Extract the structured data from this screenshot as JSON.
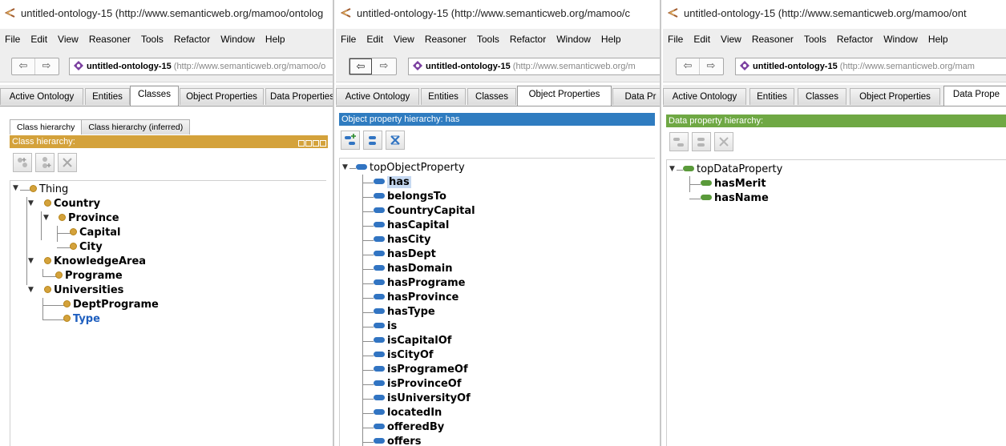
{
  "colors": {
    "class_header": "#d4a23b",
    "object_header": "#2f7cc0",
    "data_header": "#6fa844",
    "object_pill": "#3174c2",
    "data_pill": "#5a9a3a",
    "class_dot": "#d4a23b"
  },
  "panel1": {
    "title": "untitled-ontology-15 (http://www.semanticweb.org/mamoo/ontolog",
    "menu": [
      "File",
      "Edit",
      "View",
      "Reasoner",
      "Tools",
      "Refactor",
      "Window",
      "Help"
    ],
    "address": {
      "name": "untitled-ontology-15",
      "uri": "(http://www.semanticweb.org/mamoo/o"
    },
    "tabs": [
      "Active Ontology",
      "Entities",
      "Classes",
      "Object Properties",
      "Data Properties"
    ],
    "active_tab": "Classes",
    "subtabs": [
      "Class hierarchy",
      "Class hierarchy (inferred)"
    ],
    "header": "Class hierarchy:",
    "tree": [
      {
        "label": "Thing"
      },
      {
        "label": "Country"
      },
      {
        "label": "Province"
      },
      {
        "label": "Capital"
      },
      {
        "label": "City"
      },
      {
        "label": "KnowledgeArea"
      },
      {
        "label": "Programe"
      },
      {
        "label": "Universities"
      },
      {
        "label": "DeptPrograme"
      },
      {
        "label": "Type"
      }
    ]
  },
  "panel2": {
    "title": "untitled-ontology-15 (http://www.semanticweb.org/mamoo/c",
    "menu": [
      "File",
      "Edit",
      "View",
      "Reasoner",
      "Tools",
      "Refactor",
      "Window",
      "Help"
    ],
    "address": {
      "name": "untitled-ontology-15",
      "uri": "(http://www.semanticweb.org/m"
    },
    "tabs": [
      "Active Ontology",
      "Entities",
      "Classes",
      "Object Properties",
      "Data Pr"
    ],
    "active_tab": "Object Properties",
    "header": "Object property hierarchy: has",
    "root": "topObjectProperty",
    "items": [
      "has",
      "belongsTo",
      "CountryCapital",
      "hasCapital",
      "hasCity",
      "hasDept",
      "hasDomain",
      "hasPrograme",
      "hasProvince",
      "hasType",
      "is",
      "isCapitalOf",
      "isCityOf",
      "isProgrameOf",
      "isProvinceOf",
      "isUniversityOf",
      "locatedIn",
      "offeredBy",
      "offers"
    ]
  },
  "panel3": {
    "title": "untitled-ontology-15 (http://www.semanticweb.org/mamoo/ont",
    "menu": [
      "File",
      "Edit",
      "View",
      "Reasoner",
      "Tools",
      "Refactor",
      "Window",
      "Help"
    ],
    "address": {
      "name": "untitled-ontology-15",
      "uri": "(http://www.semanticweb.org/mam"
    },
    "tabs": [
      "Active Ontology",
      "Entities",
      "Classes",
      "Object Properties",
      "Data Prope"
    ],
    "active_tab": "Data Prope",
    "header": "Data property hierarchy:",
    "root": "topDataProperty",
    "items": [
      "hasMerit",
      "hasName"
    ]
  }
}
